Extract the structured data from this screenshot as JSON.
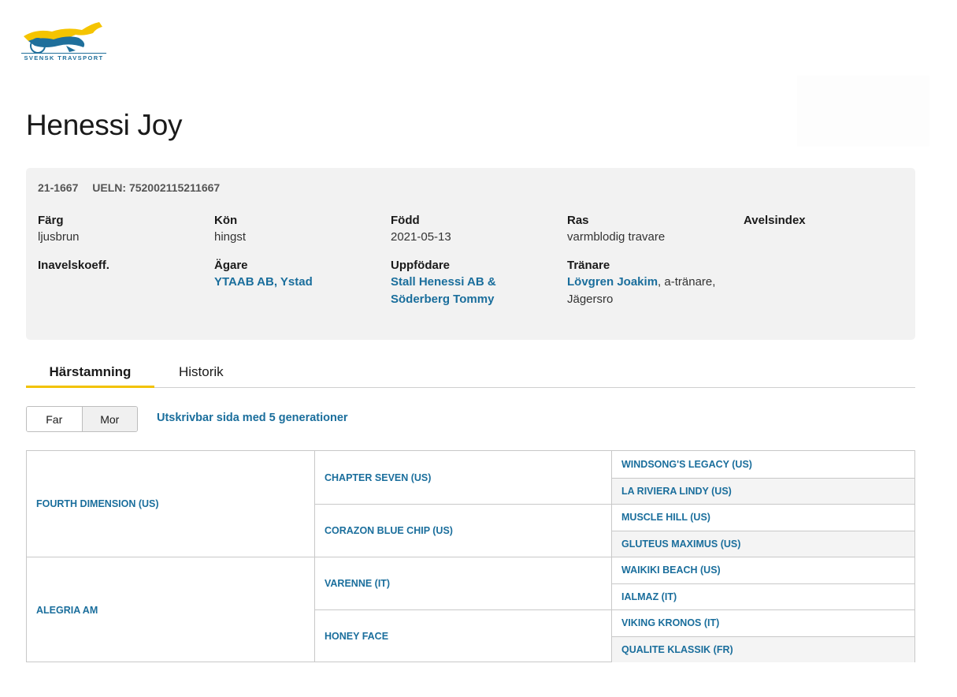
{
  "logo": {
    "text": "SVENSK TRAVSPORT"
  },
  "horse": {
    "name": "Henessi Joy",
    "reg_no": "21-1667",
    "ueln": "UELN: 752002115211667"
  },
  "details": {
    "farg": {
      "label": "Färg",
      "value": "ljusbrun"
    },
    "kon": {
      "label": "Kön",
      "value": "hingst"
    },
    "fodd": {
      "label": "Född",
      "value": "2021-05-13"
    },
    "ras": {
      "label": "Ras",
      "value": "varmblodig travare"
    },
    "avelsindex": {
      "label": "Avelsindex",
      "value": ""
    },
    "inavel": {
      "label": "Inavelskoeff.",
      "value": ""
    },
    "agare": {
      "label": "Ägare",
      "value": "YTAAB AB, Ystad"
    },
    "uppfodare": {
      "label": "Uppfödare",
      "value": "Stall Henessi AB & Söderberg Tommy"
    },
    "tranare": {
      "label": "Tränare",
      "name": "Lövgren Joakim",
      "suffix": ", a-tränare, Jägersro"
    }
  },
  "tabs": {
    "pedigree": "Härstamning",
    "history": "Historik"
  },
  "toggle": {
    "far": "Far",
    "mor": "Mor"
  },
  "print_link": "Utskrivbar sida med 5 generationer",
  "pedigree": {
    "gen1": [
      "FOURTH DIMENSION (US)",
      "ALEGRIA AM"
    ],
    "gen2": [
      "CHAPTER SEVEN (US)",
      "CORAZON BLUE CHIP (US)",
      "VARENNE (IT)",
      "HONEY FACE"
    ],
    "gen3": [
      "WINDSONG'S LEGACY (US)",
      "LA RIVIERA LINDY (US)",
      "MUSCLE HILL (US)",
      "GLUTEUS MAXIMUS (US)",
      "WAIKIKI BEACH (US)",
      "IALMAZ (IT)",
      "VIKING KRONOS (IT)",
      "QUALITE KLASSIK (FR)"
    ]
  },
  "colors": {
    "link": "#1a6e9c",
    "accent": "#f2c200",
    "card": "#f2f2f2"
  }
}
